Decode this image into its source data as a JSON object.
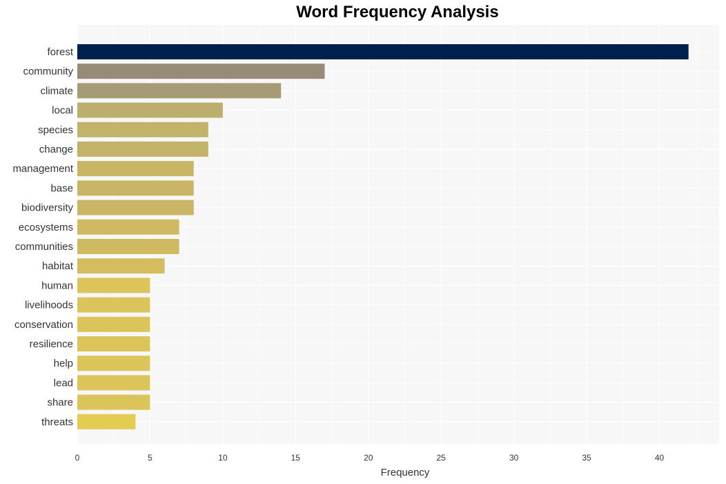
{
  "chart_data": {
    "type": "bar",
    "orientation": "horizontal",
    "title": "Word Frequency Analysis",
    "xlabel": "Frequency",
    "ylabel": "",
    "xlim": [
      0,
      44
    ],
    "xticks": [
      0,
      5,
      10,
      15,
      20,
      25,
      30,
      35,
      40
    ],
    "grid": true,
    "categories": [
      "forest",
      "community",
      "climate",
      "local",
      "species",
      "change",
      "management",
      "base",
      "biodiversity",
      "ecosystems",
      "communities",
      "habitat",
      "human",
      "livelihoods",
      "conservation",
      "resilience",
      "help",
      "lead",
      "share",
      "threats"
    ],
    "values": [
      42,
      17,
      14,
      10,
      9,
      9,
      8,
      8,
      8,
      7,
      7,
      6,
      5,
      5,
      5,
      5,
      5,
      5,
      5,
      4
    ],
    "colors": [
      "#00214d",
      "#968c77",
      "#a59b74",
      "#bcae6c",
      "#c2b26a",
      "#c2b26a",
      "#c8b666",
      "#c8b666",
      "#c8b666",
      "#cfba62",
      "#cfba62",
      "#d4bd5e",
      "#dbc459",
      "#dbc459",
      "#dbc459",
      "#dbc459",
      "#dbc459",
      "#dbc459",
      "#dbc459",
      "#e3cc52"
    ],
    "plot_background": "#f7f7f7"
  }
}
